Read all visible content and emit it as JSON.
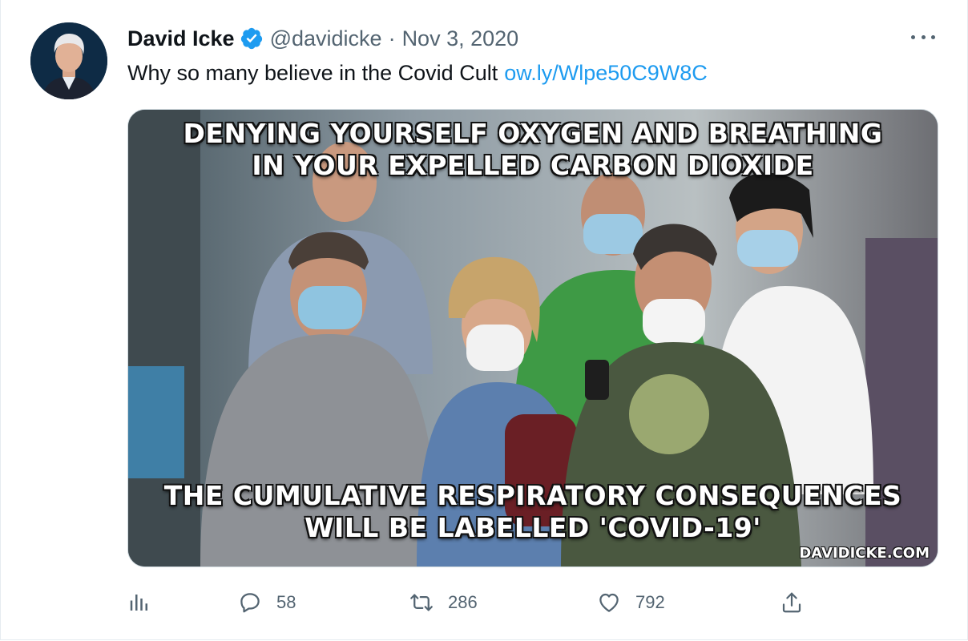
{
  "tweet": {
    "author_name": "David Icke",
    "handle": "@davidicke",
    "separator": "·",
    "date": "Nov 3, 2020",
    "text": "Why so many believe in the Covid Cult",
    "link": "ow.ly/Wlpe50C9W8C",
    "verified": true
  },
  "media": {
    "caption_top_line1": "DENYING YOURSELF OXYGEN AND BREATHING",
    "caption_top_line2": "IN YOUR EXPELLED CARBON DIOXIDE",
    "caption_bottom_line1": "THE CUMULATIVE RESPIRATORY CONSEQUENCES",
    "caption_bottom_line2": "WILL BE LABELLED 'COVID-19'",
    "watermark": "DAVIDICKE.COM"
  },
  "actions": {
    "analytics_icon": "bar-chart-icon",
    "reply_icon": "speech-bubble-icon",
    "reply_count": "58",
    "retweet_icon": "retweet-arrows-icon",
    "retweet_count": "286",
    "like_icon": "heart-icon",
    "like_count": "792",
    "share_icon": "share-upload-icon"
  },
  "colors": {
    "link": "#1d9bf0",
    "verified": "#1d9bf0",
    "secondary_text": "#536471",
    "primary_text": "#0f1419"
  }
}
